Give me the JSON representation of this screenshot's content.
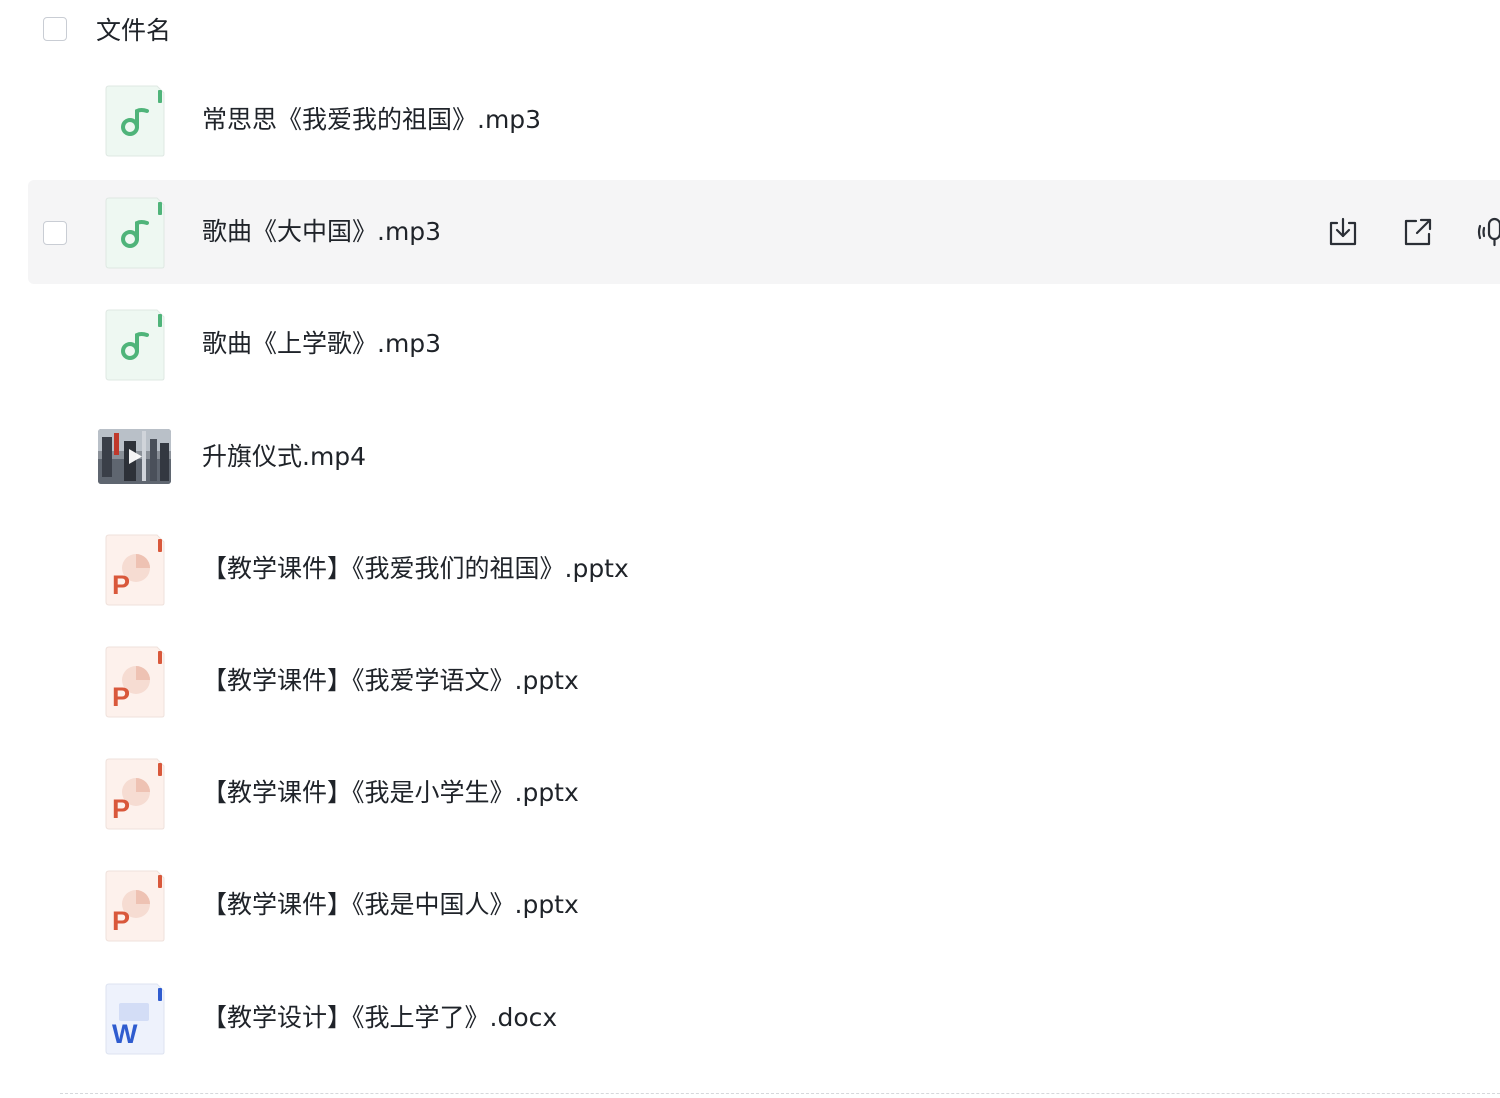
{
  "header": {
    "column_label": "文件名"
  },
  "colors": {
    "audio": "#4fb47a",
    "ppt": "#d9583b",
    "word": "#2f5ccf",
    "row_hover": "#f5f5f6"
  },
  "files": [
    {
      "name": "常思思《我爱我的祖国》.mp3",
      "icon": "music-file-icon"
    },
    {
      "name": "歌曲《大中国》.mp3",
      "icon": "music-file-icon",
      "hovered": true
    },
    {
      "name": "歌曲《上学歌》.mp3",
      "icon": "music-file-icon"
    },
    {
      "name": "升旗仪式.mp4",
      "icon": "video-thumbnail"
    },
    {
      "name": "【教学课件】《我爱我们的祖国》.pptx",
      "icon": "ppt-file-icon"
    },
    {
      "name": "【教学课件】《我爱学语文》.pptx",
      "icon": "ppt-file-icon"
    },
    {
      "name": "【教学课件】《我是小学生》.pptx",
      "icon": "ppt-file-icon"
    },
    {
      "name": "【教学课件】《我是中国人》.pptx",
      "icon": "ppt-file-icon"
    },
    {
      "name": "【教学设计】《我上学了》.docx",
      "icon": "word-file-icon"
    }
  ],
  "row_actions": [
    "download-icon",
    "share-icon",
    "listen-icon"
  ]
}
